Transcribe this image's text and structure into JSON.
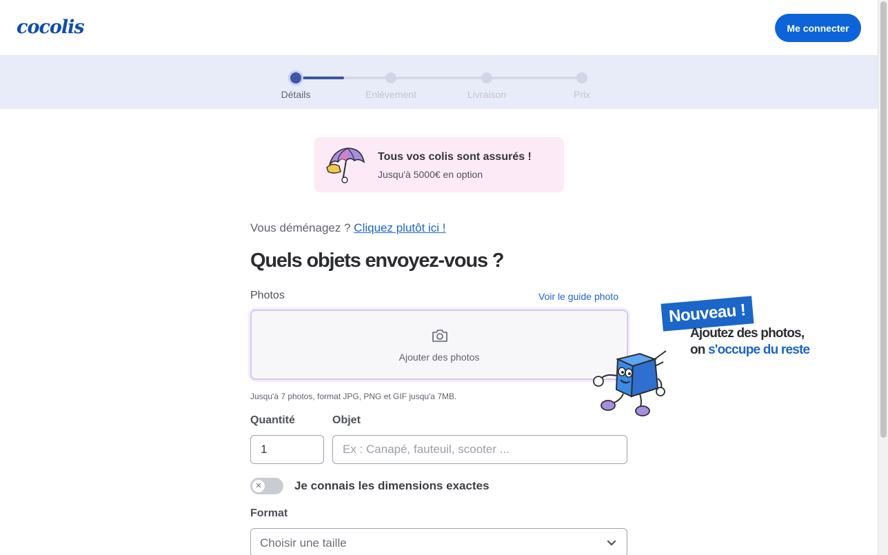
{
  "header": {
    "logo": "cocolis",
    "login_label": "Me connecter"
  },
  "stepper": {
    "steps": [
      {
        "label": "Détails",
        "active": true
      },
      {
        "label": "Enlèvement",
        "active": false
      },
      {
        "label": "Livraison",
        "active": false
      },
      {
        "label": "Prix",
        "active": false
      }
    ],
    "progress": 0.5
  },
  "insurance": {
    "title": "Tous vos colis sont assurés !",
    "subtitle": "Jusqu'à 5000€ en option",
    "icon": "umbrella-icon"
  },
  "moving": {
    "question": "Vous déménagez ?",
    "link": "Cliquez plutôt ici !"
  },
  "form": {
    "title": "Quels objets envoyez-vous ?",
    "photos_label": "Photos",
    "guide_link": "Voir le guide photo",
    "add_photos": "Ajouter des photos",
    "photos_hint": "Jusqu'à 7 photos, format JPG, PNG et GIF jusqu'a 7MB.",
    "quantity_label": "Quantité",
    "quantity_value": "1",
    "object_label": "Objet",
    "object_placeholder": "Ex : Canapé, fauteuil, scooter ...",
    "dimensions_toggle": "Je connais les dimensions exactes",
    "dimensions_on": false,
    "format_label": "Format",
    "format_selected": "Choisir une taille"
  },
  "promo": {
    "badge": "Nouveau !",
    "line1": "Ajoutez des photos,",
    "line2_prefix": "on ",
    "line2_highlight": "s'occupe du reste"
  },
  "colors": {
    "primary": "#0d64d8",
    "stepper_active": "#3d55a3",
    "insurance_bg": "#fdeaf7",
    "link": "#1a66c9"
  }
}
